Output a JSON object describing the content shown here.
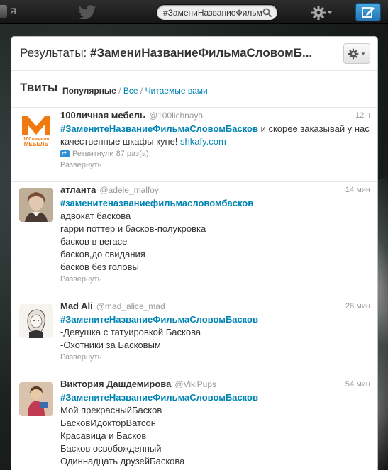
{
  "topbar": {
    "me_label": "Я",
    "search_value": "#ЗамениНазваниеФильмаС"
  },
  "page": {
    "title_prefix": "Результаты: ",
    "title_query": "#ЗамениНазваниеФильмаСловомБ..."
  },
  "tabs": {
    "heading": "Твиты",
    "popular": "Популярные",
    "sep": " / ",
    "all": "Все",
    "following": "Читаемые вами"
  },
  "tweets": [
    {
      "name": "100личная мебель",
      "handle": "@100lichnaya",
      "time": "12 ч",
      "hashtag": "#ЗаменитеНазваниеФильмаСловомБасков",
      "text_after": " и скорее заказывай у нас качественные шкафы купе!",
      "link": "shkafy.com",
      "retweet": "Ретвитнули 87 раз(а)",
      "expand": "Развернуть"
    },
    {
      "name": "атланта",
      "handle": "@adele_malfoy",
      "time": "14 мин",
      "hashtag": "#заменитеназваниефильмасловомбасков",
      "lines": [
        "адвокат баскова",
        "гарри поттер и басков-полукровка",
        "басков в вегасе",
        "басков,до свидания",
        "басков без головы"
      ],
      "expand": "Развернуть"
    },
    {
      "name": "Mad Ali",
      "handle": "@mad_alice_mad",
      "time": "28 мин",
      "hashtag": "#ЗаменитеНазваниеФильмаСловомБасков",
      "lines": [
        "-Девушка с татуировкой Баскова",
        "-Охотники за Басковым"
      ],
      "expand": "Развернуть"
    },
    {
      "name": "Виктория Дашдемирова",
      "handle": "@VikiPups",
      "time": "54 мин",
      "hashtag": "#ЗаменитеНазваниеФильмаСловомБасков",
      "lines": [
        "Мой прекрасныйБасков",
        "БасковИдокторВатсон",
        "Красавица и Басков",
        "Басков освобожденный",
        "Одиннадцать друзейБаскова"
      ]
    }
  ],
  "logo": {
    "big_letter": "M",
    "line1": "100личная",
    "line2": "МЕБЕЛЬ"
  },
  "colors": {
    "link": "#0084b4",
    "compose": "#2c85c8",
    "logo_orange": "#f07a10"
  }
}
